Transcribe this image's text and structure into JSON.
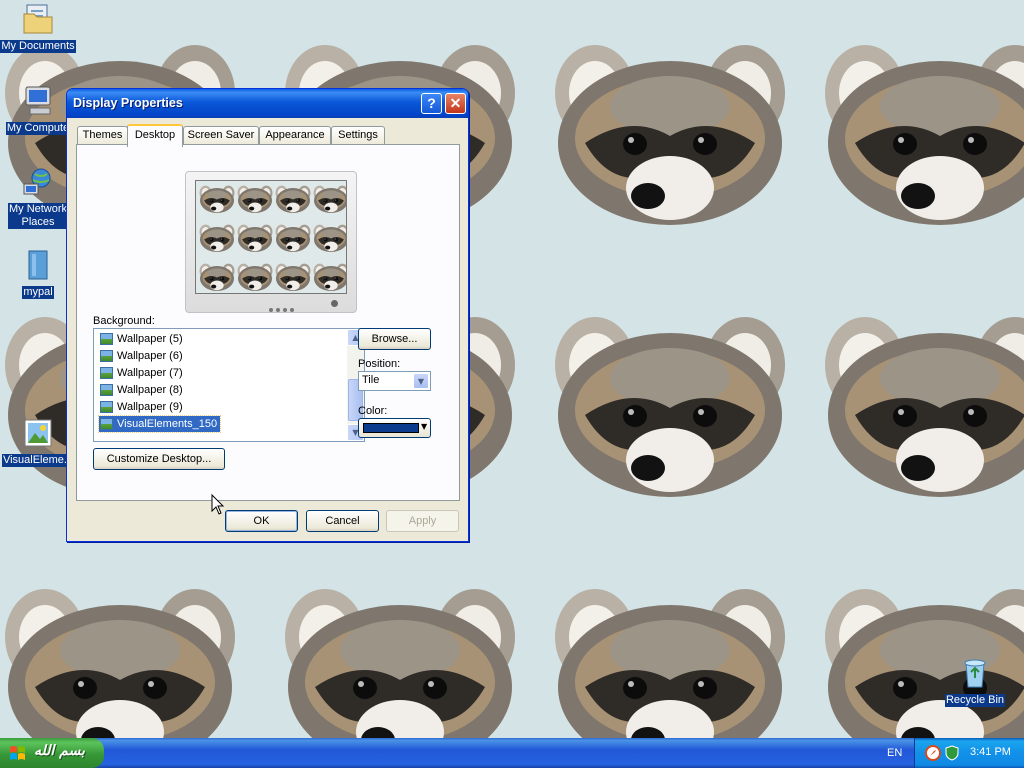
{
  "desktop": {
    "icons": [
      {
        "label": "My Documents",
        "icon": "folder-documents-icon"
      },
      {
        "label": "My Compute",
        "icon": "computer-icon"
      },
      {
        "label": "My Network",
        "label2": "Places",
        "icon": "network-icon"
      },
      {
        "label": "mypal",
        "icon": "file-icon"
      },
      {
        "label": "VisualEleme...",
        "icon": "image-file-icon"
      },
      {
        "label": "Recycle Bin",
        "icon": "recycle-bin-icon"
      }
    ]
  },
  "dialog": {
    "title": "Display Properties",
    "help_label": "?",
    "close_label": "✕",
    "tabs": [
      {
        "label": "Themes",
        "active": false
      },
      {
        "label": "Desktop",
        "active": true
      },
      {
        "label": "Screen Saver",
        "active": false
      },
      {
        "label": "Appearance",
        "active": false
      },
      {
        "label": "Settings",
        "active": false
      }
    ],
    "background_label": "Background:",
    "backgrounds": [
      {
        "label": "Wallpaper (5)",
        "selected": false
      },
      {
        "label": "Wallpaper (6)",
        "selected": false
      },
      {
        "label": "Wallpaper (7)",
        "selected": false
      },
      {
        "label": "Wallpaper (8)",
        "selected": false
      },
      {
        "label": "Wallpaper (9)",
        "selected": false
      },
      {
        "label": "VisualElements_150",
        "selected": true
      }
    ],
    "browse_label": "Browse...",
    "position_label": "Position:",
    "position_value": "Tile",
    "color_label": "Color:",
    "color_value": "#0a3b8c",
    "customize_label": "Customize Desktop...",
    "ok_label": "OK",
    "cancel_label": "Cancel",
    "apply_label": "Apply"
  },
  "taskbar": {
    "start_label": "بسم الله",
    "language": "EN",
    "clock": "3:41 PM"
  },
  "colors": {
    "wallpaper_bg": "#d4e4e6",
    "titlebar": "#0a58d8",
    "selection": "#316ac5",
    "taskbar": "#2157d7",
    "start_button": "#379737"
  }
}
